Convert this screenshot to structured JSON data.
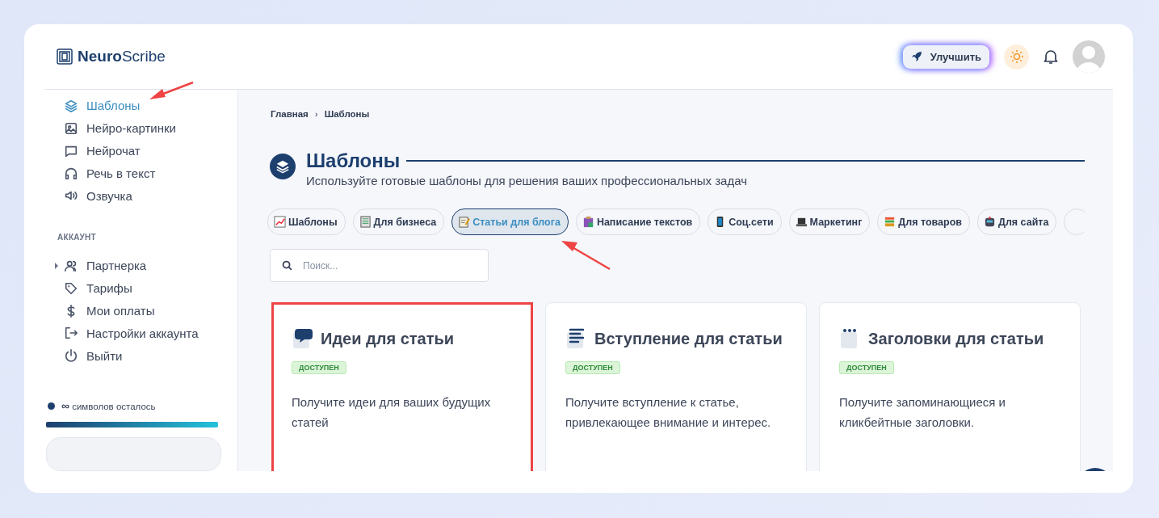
{
  "header": {
    "logo": {
      "bold": "Neuro",
      "light": "Scribe"
    },
    "upgrade_button": "Улучшить"
  },
  "sidebar": {
    "items": [
      {
        "label": "Шаблоны",
        "selected": true,
        "arrow": true
      },
      {
        "label": "Нейро-картинки",
        "selected": false,
        "arrow": false
      },
      {
        "label": "Нейрочат",
        "selected": false,
        "arrow": false
      },
      {
        "label": "Речь в текст",
        "selected": false,
        "arrow": false
      },
      {
        "label": "Озвучка",
        "selected": false,
        "arrow": false
      }
    ],
    "account_heading": "АККАУНТ",
    "account_items": [
      {
        "label": "Партнерка",
        "expanded": false
      },
      {
        "label": "Тарифы"
      },
      {
        "label": "Мои оплаты"
      },
      {
        "label": "Настройки аккаунта"
      },
      {
        "label": "Выйти"
      }
    ],
    "usage": {
      "amount": "∞",
      "label": "символов осталось",
      "level": 1,
      "color": "#1d3f6e"
    }
  },
  "main": {
    "breadcrumb": [
      "Главная",
      "Шаблоны"
    ],
    "breadcrumb_separator": "›",
    "title": "Шаблоны",
    "subtitle": "Используйте готовые шаблоны для решения ваших профессиональных задач",
    "tabs": [
      {
        "label": "Шаблоны",
        "selected": false,
        "arrow": false
      },
      {
        "label": "Для бизнеса",
        "selected": false,
        "arrow": false
      },
      {
        "label": "Статьи для блога",
        "selected": true,
        "arrow": true
      },
      {
        "label": "Написание текстов",
        "selected": false,
        "arrow": false
      },
      {
        "label": "Соц.сети",
        "selected": false,
        "arrow": false
      },
      {
        "label": "Маркетинг",
        "selected": false,
        "arrow": false
      },
      {
        "label": "Для товаров",
        "selected": false,
        "arrow": false
      },
      {
        "label": "Для сайта",
        "selected": false,
        "arrow": false
      }
    ],
    "search": {
      "placeholder": "Поиск..."
    },
    "cards": [
      {
        "title": "Идеи для статьи",
        "badge": "ДОСТУПЕН",
        "description": "Получите идеи для ваших будущих статей",
        "highlighted": true
      },
      {
        "title": "Вступление для статьи",
        "badge": "ДОСТУПЕН",
        "description": "Получите вступление к статье, привлекающее внимание и интерес.",
        "highlighted": false
      },
      {
        "title": "Заголовки для статьи",
        "badge": "ДОСТУПЕН",
        "description": "Получите запоминающиеся и кликбейтные заголовки.",
        "highlighted": false
      }
    ]
  }
}
